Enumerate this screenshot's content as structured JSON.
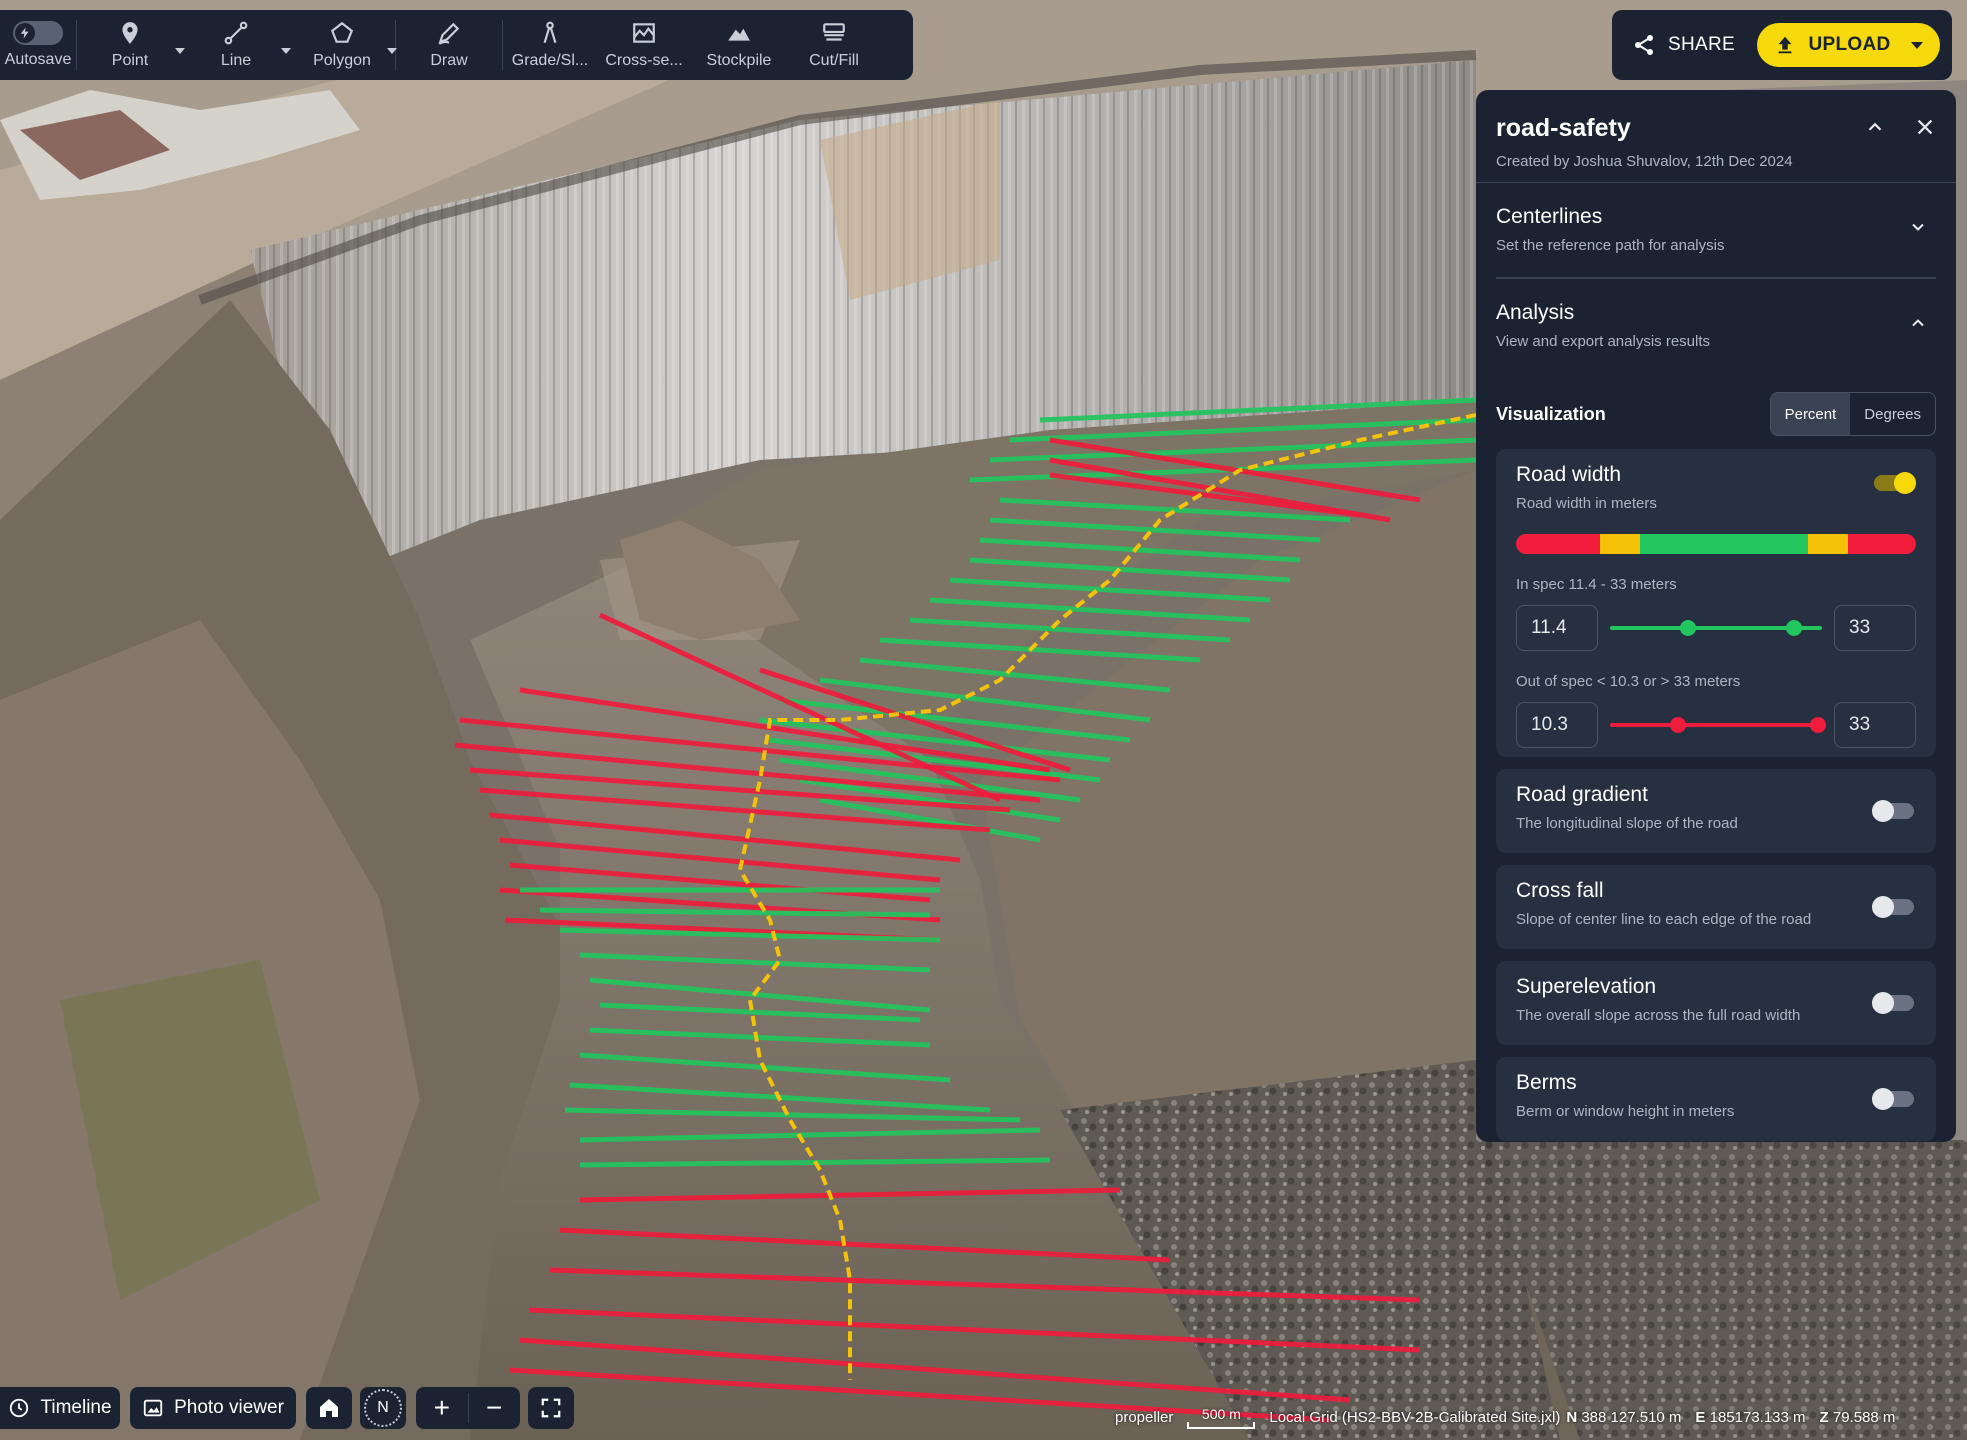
{
  "toolbar": {
    "tools": [
      {
        "label": "Autosave",
        "icon": "autosave-icon"
      },
      {
        "label": "Point",
        "icon": "point-icon"
      },
      {
        "label": "Line",
        "icon": "line-icon"
      },
      {
        "label": "Polygon",
        "icon": "polygon-icon"
      },
      {
        "label": "Draw",
        "icon": "draw-icon"
      },
      {
        "label": "Grade/Sl...",
        "icon": "grade-slope-icon"
      },
      {
        "label": "Cross-se...",
        "icon": "cross-section-icon"
      },
      {
        "label": "Stockpile",
        "icon": "stockpile-icon"
      },
      {
        "label": "Cut/Fill",
        "icon": "cut-fill-icon"
      }
    ]
  },
  "actions": {
    "share_label": "SHARE",
    "upload_label": "UPLOAD",
    "upload_color": "#f5d90a"
  },
  "panel": {
    "title": "road-safety",
    "subtitle": "Created by Joshua Shuvalov, 12th Dec 2024",
    "centerlines": {
      "title": "Centerlines",
      "subtitle": "Set the reference path for analysis"
    },
    "analysis": {
      "title": "Analysis",
      "subtitle": "View and export analysis results"
    },
    "visualization": {
      "label": "Visualization",
      "options": [
        "Percent",
        "Degrees"
      ],
      "selected": "Percent"
    },
    "road_width": {
      "title": "Road width",
      "subtitle": "Road width in meters",
      "enabled": true,
      "in_spec_label": "In spec 11.4 - 33 meters",
      "in_spec_min": "11.4",
      "in_spec_max": "33",
      "out_spec_label": "Out of spec < 10.3 or > 33 meters",
      "out_spec_min": "10.3",
      "out_spec_max": "33",
      "colors": {
        "in_spec": "#22c55e",
        "warning": "#f5c20a",
        "out_spec": "#ef1c3c"
      }
    },
    "layers": [
      {
        "title": "Road gradient",
        "subtitle": "The longitudinal slope of the road",
        "enabled": false
      },
      {
        "title": "Cross fall",
        "subtitle": "Slope of center line to each edge of the road",
        "enabled": false
      },
      {
        "title": "Superelevation",
        "subtitle": "The overall slope across the full road width",
        "enabled": false
      },
      {
        "title": "Berms",
        "subtitle": "Berm or window height in meters",
        "enabled": false
      }
    ]
  },
  "bottom": {
    "timeline_label": "Timeline",
    "photo_viewer_label": "Photo viewer",
    "compass_label": "N",
    "brand": "propeller",
    "scale_label": "500 m",
    "grid_label": "Local Grid (HS2-BBV-2B-Calibrated Site.jxl)",
    "n_label": "N",
    "n_value": "388  127.510 m",
    "e_label": "E",
    "e_value": "185173.133 m",
    "z_label": "Z",
    "z_value": "79.588 m"
  }
}
